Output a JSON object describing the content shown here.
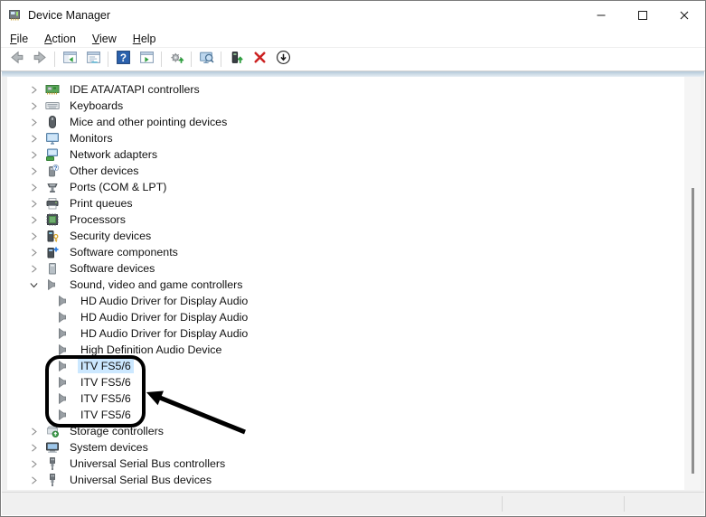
{
  "window": {
    "title": "Device Manager",
    "app_icon": "device-manager-icon",
    "controls": [
      {
        "name": "minimize"
      },
      {
        "name": "maximize"
      },
      {
        "name": "close"
      }
    ]
  },
  "menu": {
    "items": [
      {
        "label": "File"
      },
      {
        "label": "Action"
      },
      {
        "label": "View"
      },
      {
        "label": "Help"
      }
    ]
  },
  "toolbar": {
    "buttons": [
      {
        "name": "back",
        "icon": "back-arrow-icon",
        "enabled": false
      },
      {
        "name": "forward",
        "icon": "forward-arrow-icon",
        "enabled": false,
        "sep_after": true
      },
      {
        "name": "show-console-tree",
        "icon": "console-tree-icon",
        "enabled": true
      },
      {
        "name": "properties",
        "icon": "properties-icon",
        "enabled": true,
        "sep_after": true
      },
      {
        "name": "help",
        "icon": "help-icon",
        "enabled": true
      },
      {
        "name": "show-action-pane",
        "icon": "action-pane-icon",
        "enabled": true,
        "sep_after": true
      },
      {
        "name": "scan-for-hardware-changes",
        "icon": "scan-hardware-icon",
        "enabled": true,
        "sep_after": true
      },
      {
        "name": "computer-view",
        "icon": "computer-search-icon",
        "enabled": true,
        "sep_after": true
      },
      {
        "name": "update-driver",
        "icon": "update-driver-icon",
        "enabled": true
      },
      {
        "name": "uninstall-device",
        "icon": "uninstall-icon",
        "enabled": true
      },
      {
        "name": "disable-device",
        "icon": "disable-icon",
        "enabled": true
      }
    ]
  },
  "tree": {
    "rows": [
      {
        "label": "IDE ATA/ATAPI controllers",
        "icon": "ide-controller-icon",
        "level": 0,
        "state": "collapsed"
      },
      {
        "label": "Keyboards",
        "icon": "keyboard-icon",
        "level": 0,
        "state": "collapsed"
      },
      {
        "label": "Mice and other pointing devices",
        "icon": "mouse-icon",
        "level": 0,
        "state": "collapsed"
      },
      {
        "label": "Monitors",
        "icon": "monitor-icon",
        "level": 0,
        "state": "collapsed"
      },
      {
        "label": "Network adapters",
        "icon": "network-adapter-icon",
        "level": 0,
        "state": "collapsed"
      },
      {
        "label": "Other devices",
        "icon": "other-devices-icon",
        "level": 0,
        "state": "collapsed"
      },
      {
        "label": "Ports (COM & LPT)",
        "icon": "serial-port-icon",
        "level": 0,
        "state": "collapsed"
      },
      {
        "label": "Print queues",
        "icon": "printer-icon",
        "level": 0,
        "state": "collapsed"
      },
      {
        "label": "Processors",
        "icon": "processor-icon",
        "level": 0,
        "state": "collapsed"
      },
      {
        "label": "Security devices",
        "icon": "security-device-icon",
        "level": 0,
        "state": "collapsed"
      },
      {
        "label": "Software components",
        "icon": "software-component-icon",
        "level": 0,
        "state": "collapsed"
      },
      {
        "label": "Software devices",
        "icon": "software-device-icon",
        "level": 0,
        "state": "collapsed"
      },
      {
        "label": "Sound, video and game controllers",
        "icon": "speaker-icon",
        "level": 0,
        "state": "expanded"
      },
      {
        "label": "HD Audio Driver for Display Audio",
        "icon": "speaker-icon",
        "level": 1,
        "state": "none"
      },
      {
        "label": "HD Audio Driver for Display Audio",
        "icon": "speaker-icon",
        "level": 1,
        "state": "none"
      },
      {
        "label": "HD Audio Driver for Display Audio",
        "icon": "speaker-icon",
        "level": 1,
        "state": "none"
      },
      {
        "label": "High Definition Audio Device",
        "icon": "speaker-icon",
        "level": 1,
        "state": "none"
      },
      {
        "label": "ITV FS5/6",
        "icon": "speaker-icon",
        "level": 1,
        "state": "none",
        "selected": true
      },
      {
        "label": "ITV FS5/6",
        "icon": "speaker-icon",
        "level": 1,
        "state": "none"
      },
      {
        "label": "ITV FS5/6",
        "icon": "speaker-icon",
        "level": 1,
        "state": "none"
      },
      {
        "label": "ITV FS5/6",
        "icon": "speaker-icon",
        "level": 1,
        "state": "none"
      },
      {
        "label": "Storage controllers",
        "icon": "storage-controller-icon",
        "level": 0,
        "state": "collapsed"
      },
      {
        "label": "System devices",
        "icon": "system-device-icon",
        "level": 0,
        "state": "collapsed"
      },
      {
        "label": "Universal Serial Bus controllers",
        "icon": "usb-icon",
        "level": 0,
        "state": "collapsed"
      },
      {
        "label": "Universal Serial Bus devices",
        "icon": "usb-icon",
        "level": 0,
        "state": "collapsed"
      }
    ]
  },
  "annotation": {
    "shape": "rounded-box-with-arrow",
    "highlighted_items": "ITV FS5/6",
    "color": "#000000"
  },
  "colors": {
    "selection_highlight": "#cce8ff",
    "toolbar_uninstall_red": "#cc2222",
    "help_blue": "#2b62ae",
    "scan_green": "#2f9e3f"
  },
  "statusbar": {
    "text": ""
  }
}
